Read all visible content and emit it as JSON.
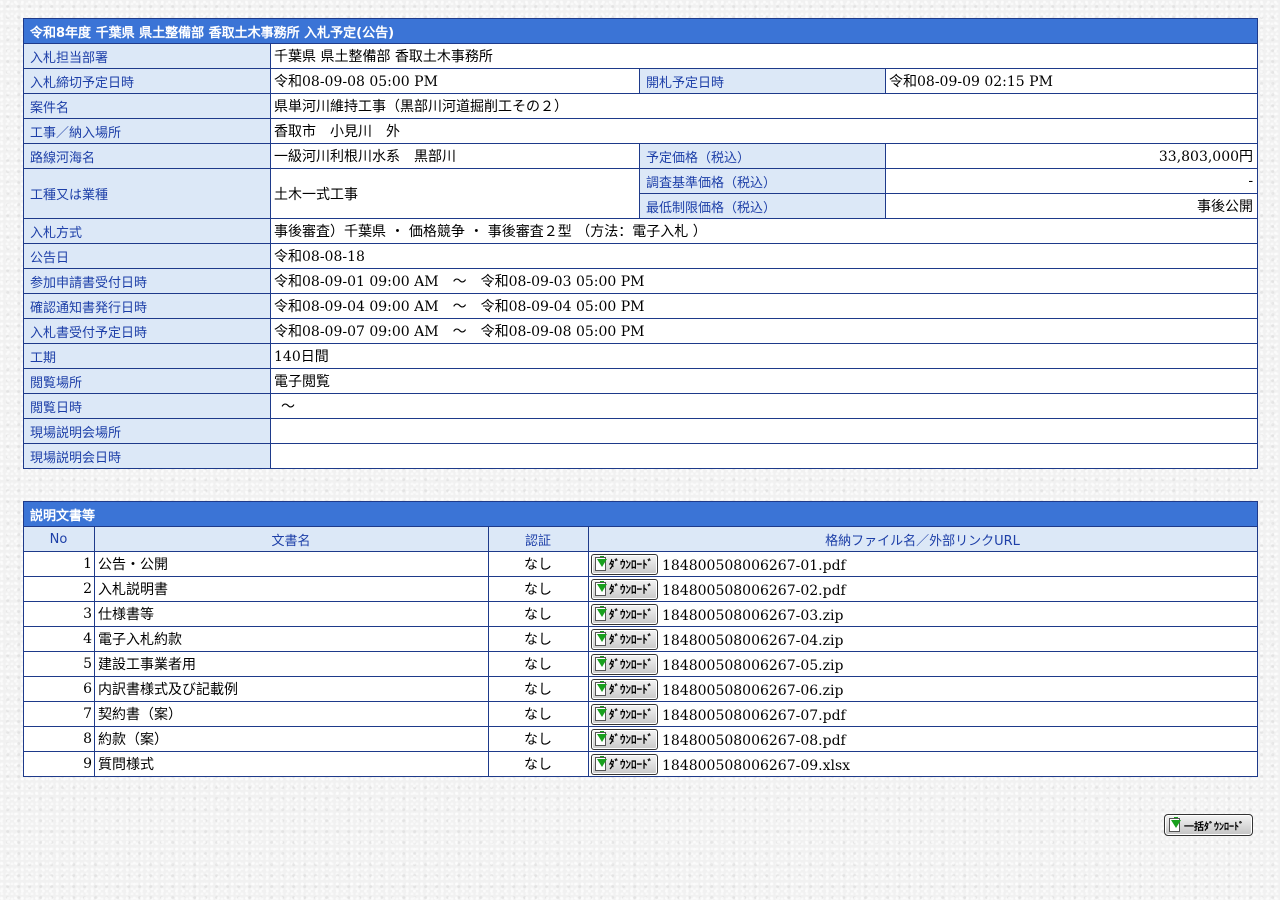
{
  "notice": {
    "title": "令和8年度  千葉県  県土整備部  香取土木事務所  入札予定(公告)",
    "rows": {
      "department": {
        "label": "入札担当部署",
        "value": "千葉県 県土整備部 香取土木事務所"
      },
      "deadline": {
        "label": "入札締切予定日時",
        "value": "令和08-09-08 05:00 PM"
      },
      "opening": {
        "label": "開札予定日時",
        "value": "令和08-09-09 02:15 PM"
      },
      "project_name": {
        "label": "案件名",
        "value": "県単河川維持工事（黒部川河道掘削工その２）"
      },
      "location": {
        "label": "工事／納入場所",
        "value": "香取市　小見川　外"
      },
      "route": {
        "label": "路線河海名",
        "value": "一級河川利根川水系　黒部川"
      },
      "planned_price": {
        "label": "予定価格（税込）",
        "value": "33,803,000円"
      },
      "work_type": {
        "label": "工種又は業種",
        "value": "土木一式工事"
      },
      "survey_price": {
        "label": "調査基準価格（税込）",
        "value": "-"
      },
      "min_price": {
        "label": "最低制限価格（税込）",
        "value": "事後公開"
      },
      "method": {
        "label": "入札方式",
        "value": "事後審査）千葉県 ・ 価格競争 ・ 事後審査２型 （方法：電子入札 ）"
      },
      "announce_date": {
        "label": "公告日",
        "value": "令和08-08-18"
      },
      "application": {
        "label": "参加申請書受付日時",
        "value": "令和08-09-01 09:00 AM　～　令和08-09-03 05:00 PM"
      },
      "confirmation": {
        "label": "確認通知書発行日時",
        "value": "令和08-09-04 09:00 AM　～　令和08-09-04 05:00 PM"
      },
      "bid_receipt": {
        "label": "入札書受付予定日時",
        "value": "令和08-09-07 09:00 AM　～　令和08-09-08 05:00 PM"
      },
      "period": {
        "label": "工期",
        "value": "140日間"
      },
      "viewing_place": {
        "label": "閲覧場所",
        "value": "電子閲覧"
      },
      "viewing_datetime": {
        "label": "閲覧日時",
        "value": "～"
      },
      "briefing_place": {
        "label": "現場説明会場所",
        "value": ""
      },
      "briefing_datetime": {
        "label": "現場説明会日時",
        "value": ""
      }
    }
  },
  "documents": {
    "title": "説明文書等",
    "columns": {
      "no": "No",
      "name": "文書名",
      "cert": "認証",
      "file": "格納ファイル名／外部リンクURL"
    },
    "download_label": "ﾀﾞｳﾝﾛｰﾄﾞ",
    "items": [
      {
        "no": "1",
        "name": "公告・公開",
        "cert": "なし",
        "file": "184800508006267-01.pdf"
      },
      {
        "no": "2",
        "name": "入札説明書",
        "cert": "なし",
        "file": "184800508006267-02.pdf"
      },
      {
        "no": "3",
        "name": "仕様書等",
        "cert": "なし",
        "file": "184800508006267-03.zip"
      },
      {
        "no": "4",
        "name": "電子入札約款",
        "cert": "なし",
        "file": "184800508006267-04.zip"
      },
      {
        "no": "5",
        "name": "建設工事業者用",
        "cert": "なし",
        "file": "184800508006267-05.zip"
      },
      {
        "no": "6",
        "name": "内訳書様式及び記載例",
        "cert": "なし",
        "file": "184800508006267-06.zip"
      },
      {
        "no": "7",
        "name": "契約書（案）",
        "cert": "なし",
        "file": "184800508006267-07.pdf"
      },
      {
        "no": "8",
        "name": "約款（案）",
        "cert": "なし",
        "file": "184800508006267-08.pdf"
      },
      {
        "no": "9",
        "name": "質問様式",
        "cert": "なし",
        "file": "184800508006267-09.xlsx"
      }
    ]
  },
  "bulk_download_label": "一括ﾀﾞｳﾝﾛｰﾄﾞ",
  "icons": {
    "download": "download-icon"
  },
  "colors": {
    "header_bg": "#3b74d6",
    "label_bg": "#dce8f7",
    "label_text": "#1d3fa8",
    "border": "#1e3a8a"
  }
}
